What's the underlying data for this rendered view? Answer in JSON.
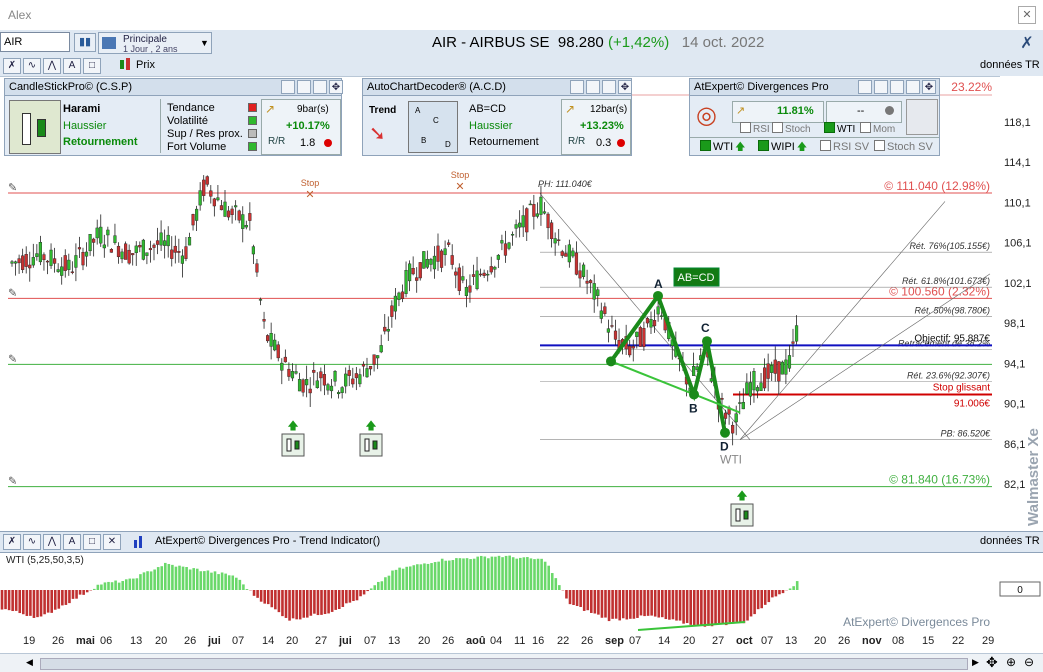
{
  "window": {
    "title": "Alex"
  },
  "toolbar": {
    "symbol_value": "AIR",
    "profile_name": "Principale",
    "profile_period": "1 Jour , 2 ans",
    "instrument": "AIR - AIRBUS SE",
    "price": "98.280",
    "change": "(+1,42%)",
    "date": "14 oct. 2022",
    "data_label": "données TR",
    "price_toggle": "Prix"
  },
  "csp": {
    "title": "CandleStickPro© (C.S.P)",
    "pattern": "Harami",
    "direction": "Haussier",
    "signal": "Retournement",
    "rows": [
      "Tendance",
      "Volatilité",
      "Sup / Res prox.",
      "Fort Volume"
    ],
    "row_colors": [
      "#e02020",
      "#2fb82f",
      "#bbbbbb",
      "#2fb82f"
    ],
    "bars": "9bar(s)",
    "perf": "+10.17%",
    "rr": "1.8"
  },
  "acd": {
    "title": "AutoChartDecoder® (A.C.D)",
    "trend_label": "Trend",
    "pattern": "AB=CD",
    "direction": "Haussier",
    "signal": "Retournement",
    "bars": "12bar(s)",
    "perf": "+13.23%",
    "rr": "0.3"
  },
  "ate": {
    "title": "AtExpert© Divergences Pro",
    "perf": "11.81%",
    "value": "--",
    "checks": [
      "RSI",
      "Stoch",
      "WTI",
      "Mom"
    ],
    "checks_on": [
      false,
      false,
      true,
      false
    ],
    "bottom": [
      "WTI",
      "WIPI",
      "RSI SV",
      "Stoch SV"
    ],
    "bottom_on": [
      true,
      true,
      false,
      false
    ]
  },
  "colors": {
    "up": "#2fb82f",
    "down": "#c83232",
    "pattern": "#1a8a1a",
    "objective": "#1010c0",
    "stop": "#d00000",
    "resist": "#e05050",
    "support": "#40b040"
  },
  "chart": {
    "top_label": "23.22%",
    "ph_label": "PH: 111.040€",
    "pb_label": "PB: 86.520€",
    "stop_icon_label": "Stop",
    "pattern_box": "AB=CD",
    "points": {
      "A": "A",
      "B": "B",
      "C": "C",
      "D": "D"
    },
    "wti_label": "WTI",
    "watermark": "Walmaster Xe",
    "levels": [
      {
        "label": "© 111.040 (12.98%)",
        "price": 111.04,
        "color": "#e05050"
      },
      {
        "label": "© 100.560 (2.32%)",
        "price": 100.56,
        "color": "#e05050"
      },
      {
        "label": "",
        "price": 94.0,
        "color": "#40b040"
      },
      {
        "label": "© 81.840 (16.73%)",
        "price": 81.84,
        "color": "#40b040"
      }
    ],
    "retr": [
      {
        "label": "Rét. 76%(105.155€)",
        "price": 105.155
      },
      {
        "label": "Rét. 61.8%(101.673€)",
        "price": 101.673
      },
      {
        "label": "Rét. 50%(98.780€)",
        "price": 98.78
      },
      {
        "label": "Retracement de 38.2%",
        "price": 95.5
      },
      {
        "label": "Rét. 23.6%(92.307€)",
        "price": 92.307
      }
    ],
    "objective_label": "Objectif: 95.887€",
    "objective_price": 95.887,
    "stop_label": "Stop glissant",
    "stop_value": "91.006€",
    "stop_price": 91.006,
    "yticks": [
      "118,1",
      "114,1",
      "110,1",
      "106,1",
      "102,1",
      "98,1",
      "94,1",
      "90,1",
      "86,1",
      "82,1"
    ],
    "ytick_prices": [
      118.1,
      114.1,
      110.1,
      106.1,
      102.1,
      98.1,
      94.1,
      90.1,
      86.1,
      82.1
    ]
  },
  "indicator": {
    "title": "AtExpert© Divergences Pro - Trend Indicator()",
    "data_label": "données TR",
    "params": "WTI (5,25,50,3,5)",
    "zero": "0",
    "watermark": "AtExpert© Divergences Pro"
  },
  "xaxis": [
    {
      "t": "19",
      "x": 31
    },
    {
      "t": "26",
      "x": 60
    },
    {
      "t": "mai",
      "x": 84,
      "b": true
    },
    {
      "t": "06",
      "x": 108
    },
    {
      "t": "13",
      "x": 138
    },
    {
      "t": "20",
      "x": 163
    },
    {
      "t": "26",
      "x": 192
    },
    {
      "t": "jui",
      "x": 216,
      "b": true
    },
    {
      "t": "07",
      "x": 240
    },
    {
      "t": "14",
      "x": 270
    },
    {
      "t": "20",
      "x": 294
    },
    {
      "t": "27",
      "x": 323
    },
    {
      "t": "jui",
      "x": 347,
      "b": true
    },
    {
      "t": "07",
      "x": 372
    },
    {
      "t": "13",
      "x": 396
    },
    {
      "t": "20",
      "x": 426
    },
    {
      "t": "26",
      "x": 450
    },
    {
      "t": "aoû",
      "x": 474,
      "b": true
    },
    {
      "t": "04",
      "x": 498
    },
    {
      "t": "11",
      "x": 522
    },
    {
      "t": "16",
      "x": 540
    },
    {
      "t": "22",
      "x": 565
    },
    {
      "t": "26",
      "x": 589
    },
    {
      "t": "sep",
      "x": 613,
      "b": true
    },
    {
      "t": "07",
      "x": 637
    },
    {
      "t": "14",
      "x": 666
    },
    {
      "t": "20",
      "x": 691
    },
    {
      "t": "27",
      "x": 720
    },
    {
      "t": "oct",
      "x": 744,
      "b": true
    },
    {
      "t": "07",
      "x": 769
    },
    {
      "t": "13",
      "x": 793
    },
    {
      "t": "20",
      "x": 822
    },
    {
      "t": "26",
      "x": 846
    },
    {
      "t": "nov",
      "x": 870,
      "b": true
    },
    {
      "t": "08",
      "x": 900
    },
    {
      "t": "15",
      "x": 930
    },
    {
      "t": "22",
      "x": 960
    },
    {
      "t": "29",
      "x": 990
    }
  ]
}
